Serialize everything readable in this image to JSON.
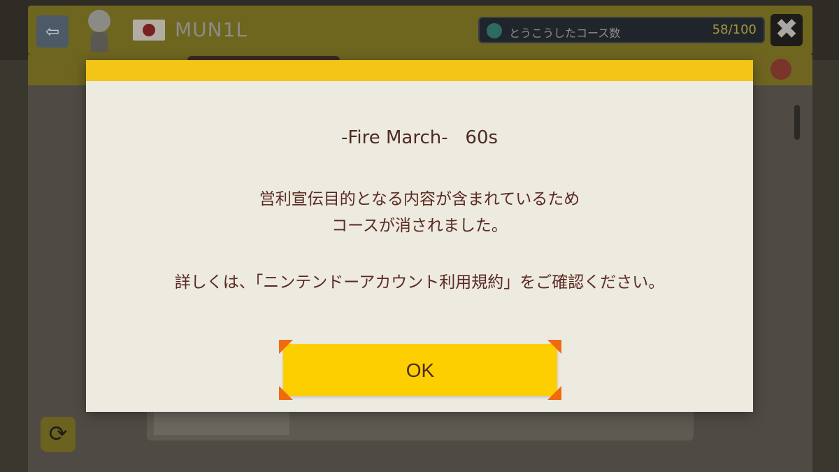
{
  "background": {
    "back_icon": "back-arrow-icon",
    "username": "MUN1L",
    "flag_icon": "japan-flag-icon",
    "stat": {
      "label": "とうこうしたコース数",
      "count": "58/100",
      "icon": "globe-icon"
    },
    "close_label": "✖",
    "refresh_label": "⟳"
  },
  "dialog": {
    "course_title": "-Fire March-   60s",
    "message_line1": "営利宣伝目的となる内容が含まれているため",
    "message_line2": "コースが消されました。",
    "detail": "詳しくは、「ニンテンドーアカウント利用規約」をご確認ください。",
    "ok_label": "OK"
  },
  "colors": {
    "accent_yellow": "#f3c516",
    "button_yellow": "#fdcf00",
    "corner_orange": "#f06a10",
    "text_brown": "#5a2a20",
    "dialog_bg": "#edeae0"
  }
}
